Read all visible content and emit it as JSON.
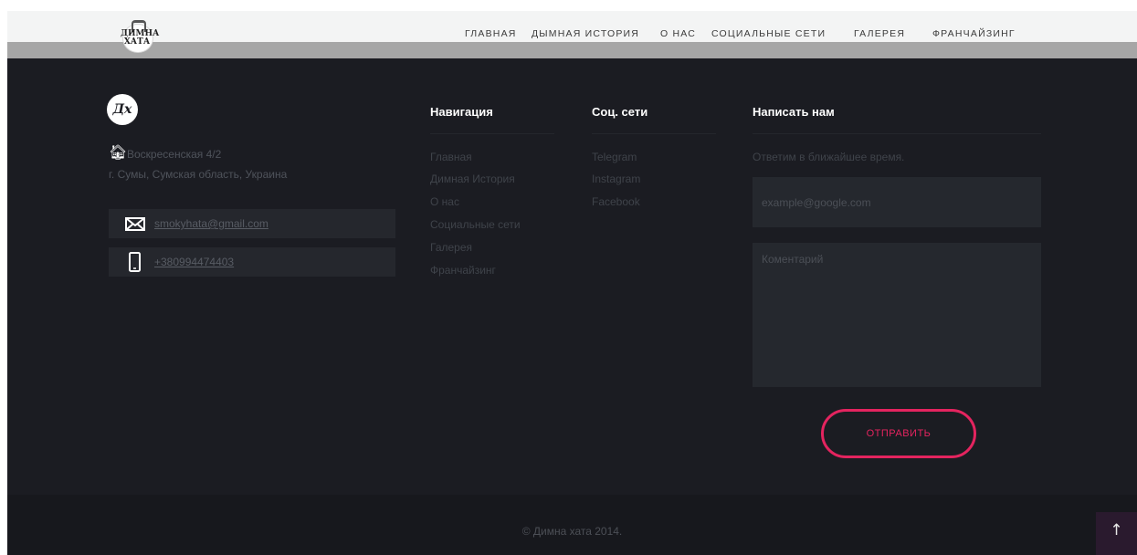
{
  "header": {
    "nav": [
      "ГЛАВНАЯ",
      "ДЫМНАЯ ИСТОРИЯ",
      "О НАС",
      "СОЦИАЛЬНЫЕ СЕТИ",
      "ГАЛЕРЕЯ",
      "ФРАНЧАЙЗИНГ"
    ],
    "logo_text": "ДИМНА\nХАТА"
  },
  "brand": {
    "monogram": "Дх"
  },
  "address": {
    "line1": "Воскресенская 4/2",
    "line2": "г. Сумы, Сумская область, Украина"
  },
  "contacts": {
    "email": "smokyhata@gmail.com",
    "phone": "+380994474403"
  },
  "navigation": {
    "title": "Навигация",
    "links": [
      "Главная",
      "Димная История",
      "О нас",
      "Социальные сети",
      "Галерея",
      "Франчайзинг"
    ]
  },
  "social": {
    "title": "Соц. сети",
    "links": [
      "Telegram",
      "Instagram",
      "Facebook"
    ]
  },
  "form": {
    "title": "Написать нам",
    "subtitle": "Ответим в ближайшее время.",
    "email_placeholder": "example@google.com",
    "comment_placeholder": "Коментарий",
    "submit_label": "ОТПРАВИТЬ"
  },
  "footer": {
    "copyright": "© Димна хата 2014."
  },
  "icons": {
    "home": "home-icon",
    "mail": "envelope-icon",
    "phone": "phone-icon",
    "to_top": "arrow-up-icon"
  },
  "colors": {
    "accent": "#e4245f",
    "background": "#1b1c22"
  }
}
